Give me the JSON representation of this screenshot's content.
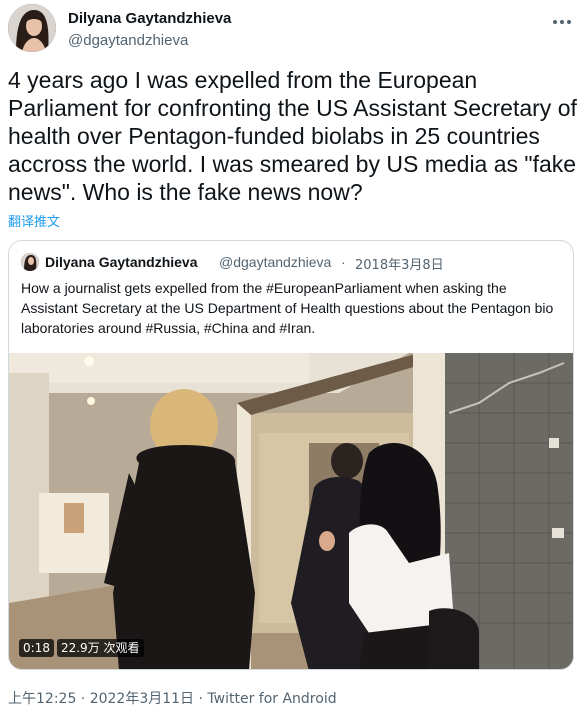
{
  "tweet": {
    "author_name": "Dilyana Gaytandzhieva",
    "author_handle": "@dgaytandzhieva",
    "more_icon": "more-horizontal-icon",
    "text": "4 years ago I was expelled from the European Parliament for confronting the US Assistant Secretary of health over Pentagon-funded biolabs in 25 countries accross the world. I was smeared by US media as \"fake news\". Who is the fake news now?",
    "translate_label": "翻译推文",
    "footer": "上午12:25 · 2022年3月11日 · Twitter for Android"
  },
  "quoted": {
    "author_name": "Dilyana Gaytandzhieva",
    "author_handle": "@dgaytandzhieva",
    "separator": "·",
    "date": "2018年3月8日",
    "text": "How a journalist gets expelled from the #EuropeanParliament when asking the Assistant Secretary at the US Department of Health questions about the Pentagon bio laboratories around #Russia, #China and #Iran.",
    "video": {
      "duration": "0:18",
      "views": "22.9万 次观看"
    }
  },
  "colors": {
    "text": "#0f1419",
    "secondary": "#536471",
    "link": "#1d9bf0",
    "border": "#cfd9de"
  }
}
